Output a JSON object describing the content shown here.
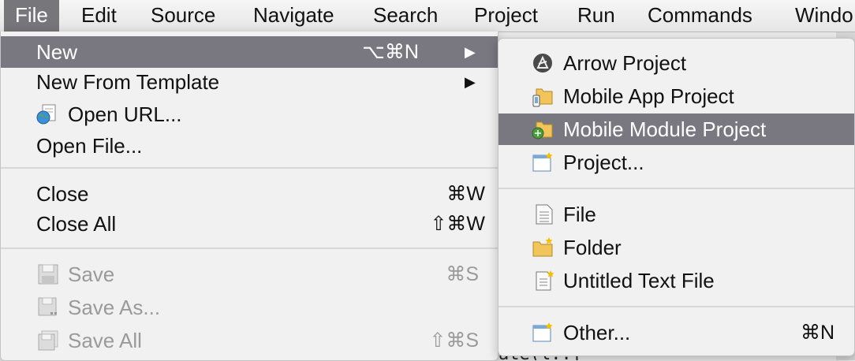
{
  "menubar": [
    "File",
    "Edit",
    "Source",
    "Navigate",
    "Search",
    "Project",
    "Run",
    "Commands",
    "Windo"
  ],
  "file_menu": {
    "new": {
      "label": "New",
      "shortcut": "⌥⌘N"
    },
    "new_from_template": {
      "label": "New From Template"
    },
    "open_url": {
      "label": "Open URL..."
    },
    "open_file": {
      "label": "Open File..."
    },
    "close": {
      "label": "Close",
      "shortcut": "⌘W"
    },
    "close_all": {
      "label": "Close All",
      "shortcut": "⇧⌘W"
    },
    "save": {
      "label": "Save",
      "shortcut": "⌘S"
    },
    "save_as": {
      "label": "Save As..."
    },
    "save_all": {
      "label": "Save All",
      "shortcut": "⇧⌘S"
    },
    "submenu_arrow": "▶"
  },
  "new_submenu": {
    "arrow_project": "Arrow Project",
    "mobile_app_project": "Mobile App Project",
    "mobile_module_project": "Mobile Module Project",
    "project": "Project...",
    "file": "File",
    "folder": "Folder",
    "untitled_text_file": "Untitled Text File",
    "other": {
      "label": "Other...",
      "shortcut": "⌘N"
    }
  },
  "background_text": "ate(l..{",
  "colors": {
    "highlight": "#797880",
    "menu_bg": "#f1f1f1",
    "disabled": "#9a9a9a"
  }
}
